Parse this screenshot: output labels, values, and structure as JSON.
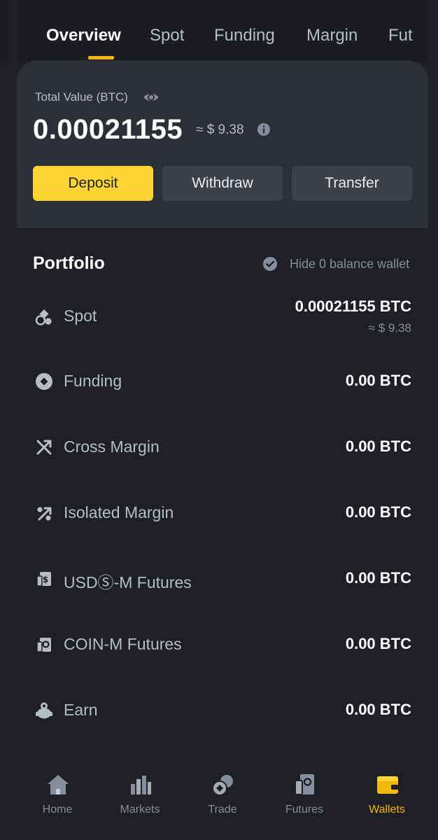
{
  "tabs": [
    {
      "label": "Overview",
      "active": true
    },
    {
      "label": "Spot"
    },
    {
      "label": "Funding"
    },
    {
      "label": "Margin"
    },
    {
      "label": "Fut"
    }
  ],
  "summary": {
    "total_label": "Total Value (BTC)",
    "total_btc": "0.00021155",
    "total_usd": "≈ $ 9.38"
  },
  "actions": {
    "deposit": "Deposit",
    "withdraw": "Withdraw",
    "transfer": "Transfer"
  },
  "portfolio": {
    "title": "Portfolio",
    "hide_zero_label": "Hide 0 balance wallet",
    "items": [
      {
        "label": "Spot",
        "value": "0.00021155 BTC",
        "sub": "≈ $ 9.38",
        "icon": "spot-icon"
      },
      {
        "label": "Funding",
        "value": "0.00 BTC",
        "icon": "funding-icon"
      },
      {
        "label": "Cross Margin",
        "value": "0.00 BTC",
        "icon": "cross-margin-icon"
      },
      {
        "label": "Isolated Margin",
        "value": "0.00 BTC",
        "icon": "isolated-margin-icon"
      },
      {
        "label": "USDⓈ-M Futures",
        "value": "0.00 BTC",
        "icon": "usd-futures-icon"
      },
      {
        "label": "COIN-M Futures",
        "value": "0.00 BTC",
        "icon": "coin-futures-icon"
      },
      {
        "label": "Earn",
        "value": "0.00 BTC",
        "icon": "earn-icon"
      }
    ]
  },
  "nav": [
    {
      "label": "Home",
      "icon": "home-icon"
    },
    {
      "label": "Markets",
      "icon": "markets-icon"
    },
    {
      "label": "Trade",
      "icon": "trade-icon"
    },
    {
      "label": "Futures",
      "icon": "futures-icon"
    },
    {
      "label": "Wallets",
      "icon": "wallet-icon",
      "active": true
    }
  ],
  "colors": {
    "background": "#1e2026",
    "card": "#2b2f36",
    "accent": "#fcd535",
    "active_tab_underline": "#f0b90b",
    "muted_text": "#848e9c"
  }
}
